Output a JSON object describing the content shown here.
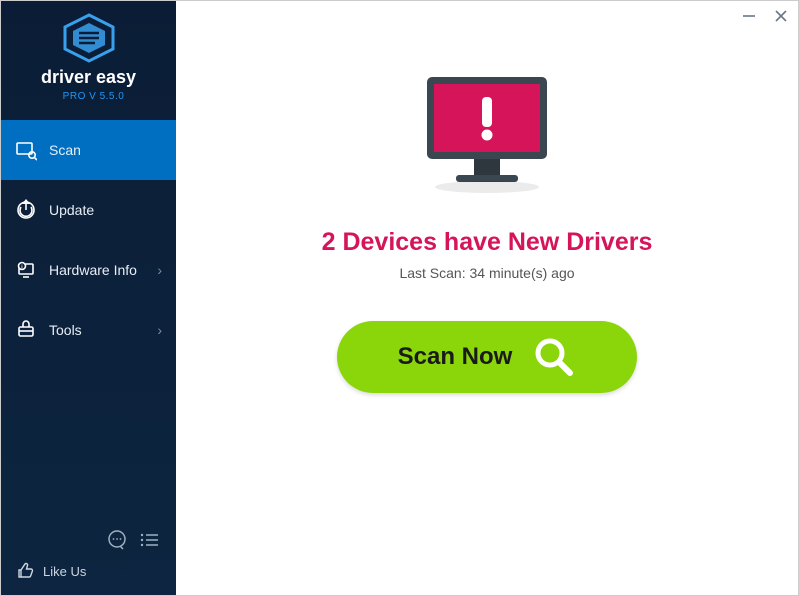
{
  "brand": {
    "name": "driver easy",
    "version_label": "PRO V 5.5.0"
  },
  "nav": {
    "scan": "Scan",
    "update": "Update",
    "hardware_info": "Hardware Info",
    "tools": "Tools"
  },
  "sidebar_footer": {
    "like_us": "Like Us"
  },
  "main": {
    "headline": "2 Devices have New Drivers",
    "last_scan": "Last Scan: 34 minute(s) ago",
    "scan_button": "Scan Now"
  },
  "colors": {
    "accent_pink": "#d5145a",
    "scan_green": "#8bd50b",
    "sidebar_active": "#006fc1"
  }
}
